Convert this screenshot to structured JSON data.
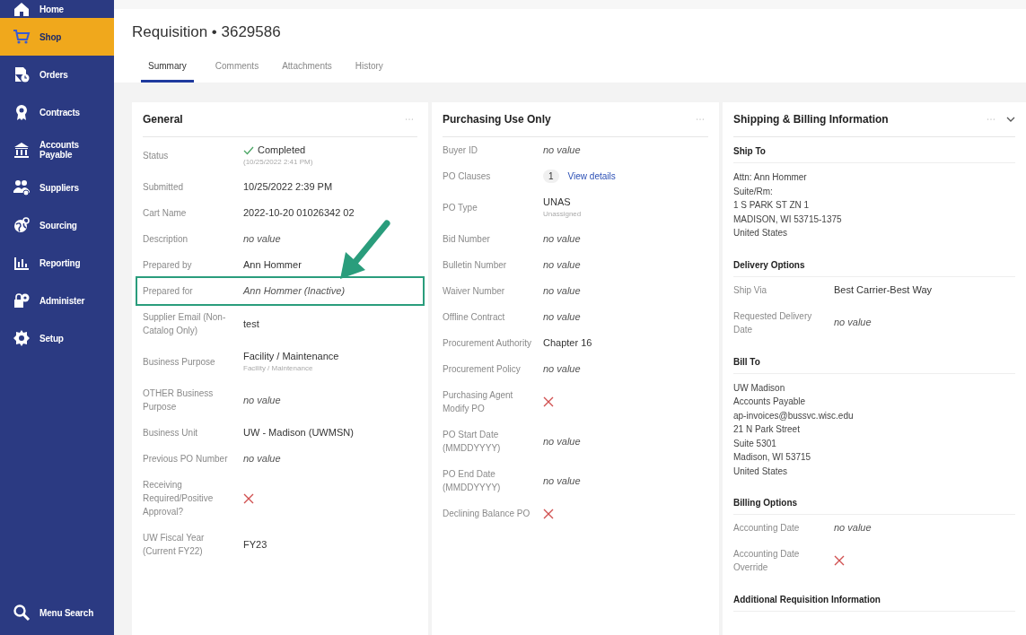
{
  "sidebar": {
    "items": [
      {
        "label": "Home",
        "selected": false
      },
      {
        "label": "Shop",
        "selected": true
      },
      {
        "label": "Orders",
        "selected": false
      },
      {
        "label": "Contracts",
        "selected": false
      },
      {
        "label": "Accounts Payable",
        "selected": false
      },
      {
        "label": "Suppliers",
        "selected": false
      },
      {
        "label": "Sourcing",
        "selected": false
      },
      {
        "label": "Reporting",
        "selected": false
      },
      {
        "label": "Administer",
        "selected": false
      },
      {
        "label": "Setup",
        "selected": false
      }
    ],
    "search": {
      "label": "Menu Search"
    }
  },
  "header": {
    "title": "Requisition • 3629586"
  },
  "tabs": [
    {
      "label": "Summary",
      "selected": true
    },
    {
      "label": "Comments",
      "selected": false
    },
    {
      "label": "Attachments",
      "selected": false
    },
    {
      "label": "History",
      "selected": false
    }
  ],
  "cards": [
    {
      "title": "General",
      "collapsible": false,
      "sections": [
        {
          "fields": [
            {
              "label": "Status",
              "kind": "status",
              "value": "Completed",
              "note": "(10/25/2022 2:41 PM)",
              "highlighted": false
            },
            {
              "label": "Submitted",
              "kind": "text",
              "value": "10/25/2022 2:39 PM",
              "highlighted": false
            },
            {
              "label": "Cart Name",
              "kind": "text",
              "value": "2022-10-20 01026342 02",
              "highlighted": false
            },
            {
              "label": "Description",
              "kind": "empty",
              "value": "no value",
              "highlighted": false
            },
            {
              "label": "Prepared by",
              "kind": "text",
              "value": "Ann Hommer",
              "highlighted": false
            },
            {
              "label": "Prepared for",
              "kind": "italic",
              "value": "Ann Hommer (Inactive)",
              "highlighted": true
            },
            {
              "label": "Supplier Email (Non-Catalog Only)",
              "kind": "text",
              "value": "test",
              "highlighted": false
            },
            {
              "label": "Business Purpose",
              "kind": "text",
              "value": "Facility / Maintenance",
              "note": "Facility / Maintenance",
              "highlighted": false
            },
            {
              "label": "OTHER Business Purpose",
              "kind": "empty",
              "value": "no value",
              "highlighted": false
            },
            {
              "label": "Business Unit",
              "kind": "text",
              "value": "UW - Madison (UWMSN)",
              "highlighted": false
            },
            {
              "label": "Previous PO Number",
              "kind": "empty",
              "value": "no value",
              "highlighted": false
            },
            {
              "label": "Receiving Required/Positive Approval?",
              "kind": "cross",
              "highlighted": false
            },
            {
              "label": "UW Fiscal Year (Current FY22)",
              "kind": "text",
              "value": "FY23",
              "highlighted": false
            }
          ]
        }
      ]
    },
    {
      "title": "Purchasing Use Only",
      "collapsible": false,
      "sections": [
        {
          "fields": [
            {
              "label": "Buyer ID",
              "kind": "empty",
              "value": "no value",
              "highlighted": false
            },
            {
              "label": "PO Clauses",
              "kind": "clauses",
              "count": "1",
              "link": "View details",
              "highlighted": false
            },
            {
              "label": "PO Type",
              "kind": "text",
              "value": "UNAS",
              "note": "Unassigned",
              "highlighted": false
            },
            {
              "label": "Bid Number",
              "kind": "empty",
              "value": "no value",
              "highlighted": false
            },
            {
              "label": "Bulletin Number",
              "kind": "empty",
              "value": "no value",
              "highlighted": false
            },
            {
              "label": "Waiver Number",
              "kind": "empty",
              "value": "no value",
              "highlighted": false
            },
            {
              "label": "Offline Contract",
              "kind": "empty",
              "value": "no value",
              "highlighted": false
            },
            {
              "label": "Procurement Authority",
              "kind": "text",
              "value": "Chapter 16",
              "highlighted": false
            },
            {
              "label": "Procurement Policy",
              "kind": "empty",
              "value": "no value",
              "highlighted": false
            },
            {
              "label": "Purchasing Agent Modify PO",
              "kind": "cross",
              "highlighted": false
            },
            {
              "label": "PO Start Date (MMDDYYYY)",
              "kind": "empty",
              "value": "no value",
              "highlighted": false
            },
            {
              "label": "PO End Date (MMDDYYYY)",
              "kind": "empty",
              "value": "no value",
              "highlighted": false
            },
            {
              "label": "Declining Balance PO",
              "kind": "cross",
              "highlighted": false
            }
          ]
        }
      ]
    },
    {
      "title": "Shipping & Billing Information",
      "collapsible": true,
      "sections": [
        {
          "heading": "Ship To",
          "lines": [
            "Attn: Ann Hommer",
            "Suite/Rm:",
            "1 S PARK ST ZN 1",
            "MADISON, WI 53715-1375",
            "United States"
          ]
        },
        {
          "heading": "Delivery Options",
          "fields": [
            {
              "label": "Ship Via",
              "kind": "text",
              "value": "Best Carrier-Best Way",
              "highlighted": false
            },
            {
              "label": "Requested Delivery Date",
              "kind": "empty",
              "value": "no value",
              "highlighted": false
            }
          ]
        },
        {
          "heading": "Bill To",
          "lines": [
            "UW Madison",
            "Accounts Payable",
            "ap-invoices@bussvc.wisc.edu",
            "21 N Park Street",
            "Suite 5301",
            "Madison, WI 53715",
            "United States"
          ]
        },
        {
          "heading": "Billing Options",
          "fields": [
            {
              "label": "Accounting Date",
              "kind": "empty",
              "value": "no value",
              "highlighted": false
            },
            {
              "label": "Accounting Date Override",
              "kind": "cross",
              "highlighted": false
            }
          ]
        },
        {
          "heading": "Additional Requisition Information"
        }
      ]
    }
  ]
}
